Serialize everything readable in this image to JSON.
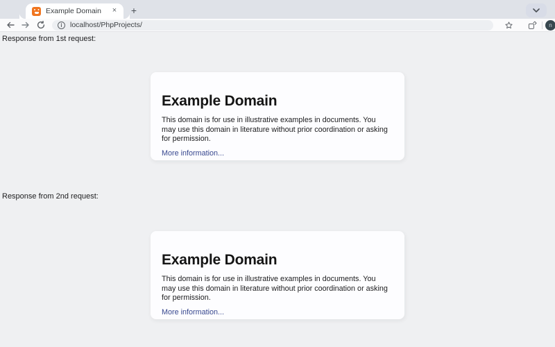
{
  "browser": {
    "tab": {
      "title": "Example Domain",
      "close_glyph": "×"
    },
    "new_tab_glyph": "+",
    "url": "localhost/PhpProjects/",
    "site_info_glyph": "i",
    "avatar_letter": "n"
  },
  "page": {
    "sections": [
      {
        "label": "Response from 1st request:"
      },
      {
        "label": "Response from 2nd request:"
      }
    ],
    "card": {
      "title": "Example Domain",
      "body": "This domain is for use in illustrative examples in documents. You may use this domain in literature without prior coordination or asking for permission.",
      "link": "More information..."
    }
  },
  "colors": {
    "favicon_orange": "#F0751F",
    "tabstrip_bg": "#DFE2E8",
    "page_bg": "#EFF0F2",
    "card_bg": "#FDFDFF",
    "link": "#38488F",
    "avatar_bg": "#37474F"
  }
}
